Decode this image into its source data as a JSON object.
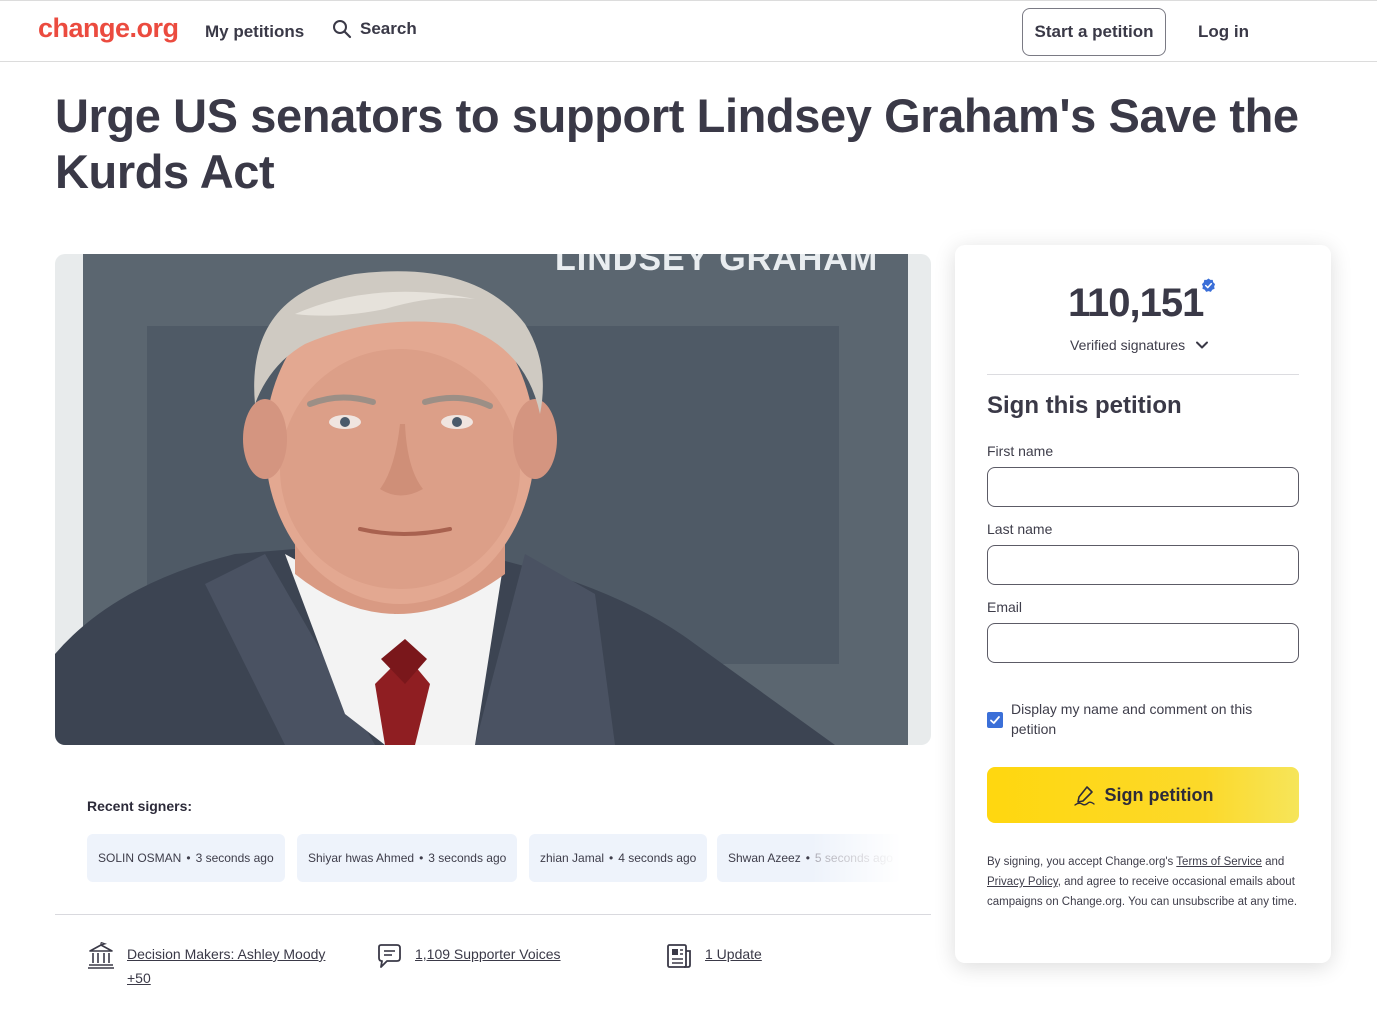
{
  "header": {
    "logo": "change.org",
    "my_petitions": "My petitions",
    "search": "Search",
    "start_petition": "Start a petition",
    "log_in": "Log in"
  },
  "petition": {
    "title": "Urge US senators to support Lindsey Graham's Save the Kurds Act",
    "image_caption": "LINDSEY GRAHAM"
  },
  "recent_signers": {
    "label": "Recent signers:",
    "items": [
      {
        "name": "SOLIN OSMAN",
        "time": "3 seconds ago"
      },
      {
        "name": "Shiyar hwas Ahmed",
        "time": "3 seconds ago"
      },
      {
        "name": "zhian Jamal",
        "time": "4 seconds ago"
      },
      {
        "name": "Shwan Azeez",
        "time": "5 seconds ago"
      }
    ]
  },
  "meta": {
    "decision_makers": "Decision Makers: Ashley Moody +50",
    "supporter_voices": "1,109 Supporter Voices",
    "updates": "1 Update"
  },
  "sign_card": {
    "count": "110,151",
    "count_label": "Verified signatures",
    "title": "Sign this petition",
    "first_name_label": "First name",
    "last_name_label": "Last name",
    "email_label": "Email",
    "first_name_value": "",
    "last_name_value": "",
    "email_value": "",
    "display_checkbox_label": "Display my name and comment on this petition",
    "display_checked": true,
    "sign_button": "Sign petition",
    "legal_prefix": "By signing, you accept Change.org's ",
    "terms_link": "Terms of Service",
    "legal_and": " and ",
    "privacy_link": "Privacy Policy",
    "legal_suffix": ", and agree to receive occasional emails about campaigns on Change.org. You can unsubscribe at any time."
  },
  "colors": {
    "brand_red": "#eb4b3f",
    "text_dark": "#3a3947",
    "sign_button_yellow": "#ffd70f",
    "checkbox_blue": "#3b6fd8",
    "signer_chip_bg": "#eef3fb"
  }
}
